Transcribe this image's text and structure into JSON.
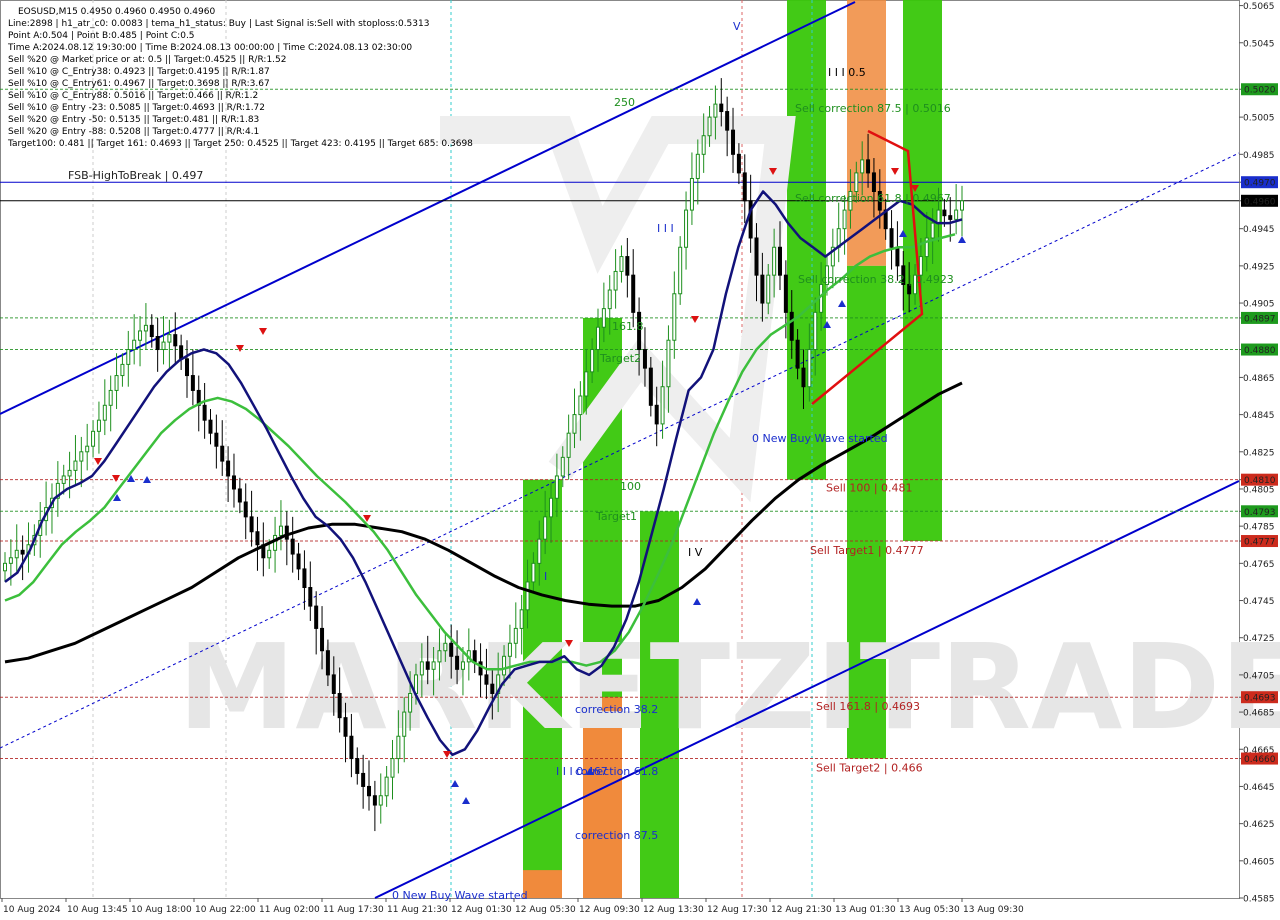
{
  "header": {
    "title": "EOSUSD,M15  0.4950 0.4960 0.4950 0.4960",
    "lines": [
      "Line:2898 | h1_atr_c0: 0.0083 | tema_h1_status: Buy | Last Signal is:Sell with stoploss:0.5313",
      "Point A:0.504 | Point B:0.485 | Point C:0.5",
      "Time A:2024.08.12 19:30:00 | Time B:2024.08.13 00:00:00 | Time C:2024.08.13 02:30:00",
      "Sell %20 @ Market price or at: 0.5 || Target:0.4525 || R/R:1.52",
      "Sell %10 @ C_Entry38: 0.4923 || Target:0.4195 || R/R:1.87",
      "Sell %10 @ C_Entry61: 0.4967 || Target:0.3698 || R/R:3.67",
      "Sell %10 @ C_Entry88: 0.5016 || Target:0.466 || R/R:1.2",
      "Sell %10 @ Entry -23: 0.5085 || Target:0.4693 || R/R:1.72",
      "Sell %20 @ Entry -50: 0.5135 || Target:0.481 || R/R:1.83",
      "Sell %20 @ Entry -88: 0.5208 || Target:0.4777 || R/R:4.1",
      "Target100: 0.481 || Target 161: 0.4693 || Target 250: 0.4525 || Target 423: 0.4195 || Target 685: 0.3698"
    ]
  },
  "chart_data": {
    "type": "candlestick",
    "symbol": "EOSUSD",
    "timeframe": "M15",
    "ylim": [
      0.4585,
      0.5068
    ],
    "y_ticks": [
      "0.5065",
      "0.5045",
      "0.5020",
      "0.5005",
      "0.4985",
      "0.4970",
      "0.4960",
      "0.4945",
      "0.4925",
      "0.4905",
      "0.4897",
      "0.4880",
      "0.4865",
      "0.4845",
      "0.4825",
      "0.4810",
      "0.4805",
      "0.4793",
      "0.4785",
      "0.4777",
      "0.4765",
      "0.4745",
      "0.4725",
      "0.4705",
      "0.4693",
      "0.4685",
      "0.4665",
      "0.4660",
      "0.4645",
      "0.4625",
      "0.4605",
      "0.4585"
    ],
    "x_ticks": [
      "10 Aug 2024",
      "10 Aug 13:45",
      "10 Aug 18:00",
      "10 Aug 22:00",
      "11 Aug 02:00",
      "11 Aug 17:30",
      "11 Aug 21:30",
      "12 Aug 01:30",
      "12 Aug 05:30",
      "12 Aug 09:30",
      "12 Aug 13:30",
      "12 Aug 17:30",
      "12 Aug 21:30",
      "13 Aug 01:30",
      "13 Aug 05:30",
      "13 Aug 09:30"
    ],
    "close_path": [
      0.4765,
      0.4768,
      0.4772,
      0.477,
      0.4775,
      0.478,
      0.4788,
      0.4795,
      0.48,
      0.4808,
      0.4812,
      0.4815,
      0.482,
      0.4825,
      0.4828,
      0.4836,
      0.4842,
      0.485,
      0.4858,
      0.4866,
      0.4872,
      0.488,
      0.4885,
      0.489,
      0.4893,
      0.4887,
      0.488,
      0.4884,
      0.4888,
      0.4882,
      0.4875,
      0.4866,
      0.4858,
      0.485,
      0.4842,
      0.4835,
      0.4828,
      0.482,
      0.4812,
      0.4805,
      0.4798,
      0.479,
      0.4782,
      0.4775,
      0.4768,
      0.4772,
      0.478,
      0.4785,
      0.4778,
      0.477,
      0.4762,
      0.4752,
      0.4742,
      0.473,
      0.4718,
      0.4705,
      0.4695,
      0.4682,
      0.4672,
      0.466,
      0.4652,
      0.4645,
      0.464,
      0.4635,
      0.464,
      0.465,
      0.466,
      0.4672,
      0.4685,
      0.4695,
      0.4705,
      0.4712,
      0.4708,
      0.4712,
      0.4718,
      0.4722,
      0.4715,
      0.4708,
      0.4712,
      0.4718,
      0.4712,
      0.4705,
      0.47,
      0.4695,
      0.4705,
      0.4715,
      0.4722,
      0.473,
      0.474,
      0.4755,
      0.4765,
      0.4778,
      0.479,
      0.48,
      0.4812,
      0.4822,
      0.4835,
      0.4845,
      0.4855,
      0.4868,
      0.488,
      0.4892,
      0.4902,
      0.4912,
      0.4922,
      0.493,
      0.492,
      0.49,
      0.488,
      0.487,
      0.485,
      0.484,
      0.486,
      0.4885,
      0.491,
      0.4935,
      0.4955,
      0.4972,
      0.4985,
      0.4995,
      0.5005,
      0.5012,
      0.5008,
      0.4998,
      0.4985,
      0.4975,
      0.496,
      0.494,
      0.492,
      0.4905,
      0.492,
      0.4935,
      0.492,
      0.49,
      0.4885,
      0.487,
      0.486,
      0.488,
      0.49,
      0.4915,
      0.4925,
      0.4935,
      0.4945,
      0.4955,
      0.4965,
      0.4975,
      0.4982,
      0.4975,
      0.4965,
      0.4955,
      0.4945,
      0.4935,
      0.4925,
      0.4915,
      0.491,
      0.492,
      0.493,
      0.494,
      0.4948,
      0.4955,
      0.4952,
      0.495,
      0.4955,
      0.496
    ],
    "ema_navy": [
      0.4755,
      0.476,
      0.4772,
      0.4788,
      0.48,
      0.4805,
      0.4808,
      0.4812,
      0.482,
      0.483,
      0.484,
      0.485,
      0.486,
      0.4868,
      0.4874,
      0.4878,
      0.488,
      0.4878,
      0.4872,
      0.4862,
      0.485,
      0.4838,
      0.4825,
      0.4812,
      0.48,
      0.479,
      0.4785,
      0.4778,
      0.4768,
      0.4755,
      0.474,
      0.4725,
      0.471,
      0.4695,
      0.4682,
      0.467,
      0.4662,
      0.4665,
      0.4675,
      0.4688,
      0.47,
      0.4708,
      0.471,
      0.4712,
      0.4712,
      0.4715,
      0.4708,
      0.4705,
      0.471,
      0.472,
      0.4735,
      0.4755,
      0.478,
      0.4805,
      0.4832,
      0.4858,
      0.4865,
      0.488,
      0.491,
      0.4935,
      0.4955,
      0.4965,
      0.4958,
      0.4948,
      0.494,
      0.4935,
      0.493,
      0.4935,
      0.494,
      0.4945,
      0.495,
      0.4955,
      0.496,
      0.4958,
      0.4952,
      0.4948,
      0.4948,
      0.495
    ],
    "ema_green": [
      0.4745,
      0.4748,
      0.4755,
      0.4765,
      0.4775,
      0.4782,
      0.4788,
      0.4795,
      0.4805,
      0.4815,
      0.4825,
      0.4835,
      0.4842,
      0.4848,
      0.4852,
      0.4854,
      0.4852,
      0.4848,
      0.4842,
      0.4835,
      0.4828,
      0.482,
      0.4812,
      0.4805,
      0.4798,
      0.479,
      0.4782,
      0.4772,
      0.476,
      0.4748,
      0.4738,
      0.4728,
      0.472,
      0.4712,
      0.4708,
      0.4708,
      0.471,
      0.4712,
      0.4712,
      0.4712,
      0.4712,
      0.471,
      0.4712,
      0.4718,
      0.4728,
      0.4742,
      0.4758,
      0.4775,
      0.4795,
      0.4815,
      0.4835,
      0.4852,
      0.4868,
      0.488,
      0.4888,
      0.4893,
      0.4898,
      0.4905,
      0.4912,
      0.4918,
      0.4925,
      0.493,
      0.4933,
      0.4935,
      0.4935,
      0.4938,
      0.494,
      0.4942
    ],
    "ma_black": [
      0.4712,
      0.4714,
      0.4718,
      0.4722,
      0.4728,
      0.4734,
      0.474,
      0.4746,
      0.4752,
      0.476,
      0.4768,
      0.4774,
      0.478,
      0.4784,
      0.4786,
      0.4786,
      0.4784,
      0.4782,
      0.4778,
      0.4772,
      0.4765,
      0.4758,
      0.4752,
      0.4748,
      0.4745,
      0.4743,
      0.4742,
      0.4742,
      0.4745,
      0.4752,
      0.4762,
      0.4775,
      0.4788,
      0.48,
      0.481,
      0.4818,
      0.4825,
      0.4832,
      0.484,
      0.4848,
      0.4856,
      0.4862
    ],
    "horizontal_levels": [
      {
        "name": "FSB-HighToBreak",
        "value": 0.497,
        "label": "FSB-HighToBreak | 0.497",
        "price_tag": "0.4970",
        "color": "#0000cc"
      },
      {
        "name": "current",
        "value": 0.496,
        "price_tag": "0.4960",
        "color": "#000000"
      },
      {
        "name": "level-5020",
        "value": 0.502,
        "price_tag": "0.5020",
        "color": "#1e8f1e"
      },
      {
        "name": "level-4897",
        "value": 0.4897,
        "price_tag": "0.4897",
        "color": "#1e8f1e"
      },
      {
        "name": "level-4880",
        "value": 0.488,
        "price_tag": "0.4880",
        "color": "#1e8f1e"
      },
      {
        "name": "Sell 100",
        "value": 0.481,
        "label": "Sell 100 | 0.481",
        "price_tag": "0.4810",
        "color": "#b22222"
      },
      {
        "name": "level-4793",
        "value": 0.4793,
        "price_tag": "0.4793",
        "color": "#1e8f1e"
      },
      {
        "name": "Sell Target1",
        "value": 0.4777,
        "label": "Sell Target1 | 0.4777",
        "price_tag": "0.4777",
        "color": "#b22222"
      },
      {
        "name": "Sell 161.8",
        "value": 0.4693,
        "label": "Sell 161.8 | 0.4693",
        "price_tag": "0.4693",
        "color": "#b22222"
      },
      {
        "name": "Sell Target2",
        "value": 0.466,
        "label": "Sell Target2 | 0.466",
        "price_tag": "0.4660",
        "color": "#b22222"
      }
    ],
    "annotations": [
      "250",
      "I I I 0.5",
      "Sell correction 87.5 | 0.5016",
      "Sell correction 61.8 | 0.4967",
      "Sell correction 38.2 | 0.4923",
      "0 New Buy Wave started",
      "161.8",
      "Target2",
      "Target1",
      "100",
      "I I I",
      "I V",
      "V",
      "I",
      "correction 38.2",
      "I I I 0.467",
      "correction 61.8",
      "correction 87.5",
      "0 New Buy Wave started"
    ],
    "watermark": "MARKETZITRADE"
  },
  "colors": {
    "bg": "#ffffff",
    "bull": "#1e8f1e",
    "bear": "#000000",
    "channel": "#0000cc",
    "zone_green": "#38c70a",
    "zone_orange": "#f08a3c",
    "sell_red": "#b22222",
    "tag_green": "#1e9a1e",
    "tag_red": "#cc2b1d",
    "tag_blue": "#1a2ecc"
  }
}
